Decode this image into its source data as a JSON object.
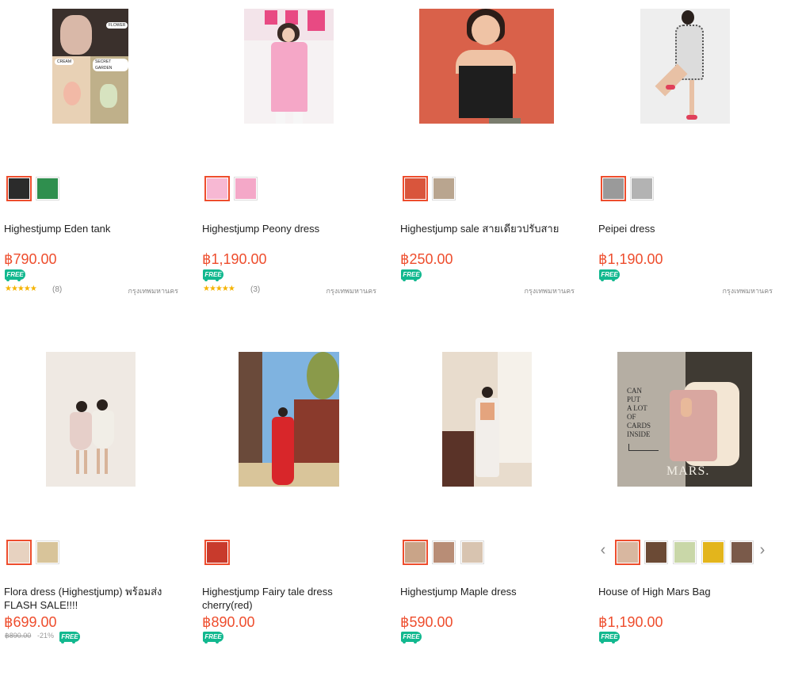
{
  "products": [
    {
      "name": "Highestjump Eden tank",
      "price": "฿790.00",
      "free_label": "FREE",
      "stars": "★★★★★",
      "reviews": "(8)",
      "location": "กรุงเทพมหานคร",
      "image_labels": [
        "FLOWER",
        "CREAM",
        "SECRET GARDEN"
      ],
      "swatch_colors": [
        "#2b2b2b",
        "#2f8f4e"
      ]
    },
    {
      "name": "Highestjump Peony dress",
      "price": "฿1,190.00",
      "free_label": "FREE",
      "stars": "★★★★★",
      "reviews": "(3)",
      "location": "กรุงเทพมหานคร",
      "swatch_colors": [
        "#f7b8d3",
        "#f4a8c8"
      ]
    },
    {
      "name": "Highestjump sale สายเดียวปรับสาย",
      "price": "฿250.00",
      "free_label": "FREE",
      "location": "กรุงเทพมหานคร",
      "swatch_colors": [
        "#d9553c",
        "#b9a58f"
      ]
    },
    {
      "name": "Peipei dress",
      "price": "฿1,190.00",
      "free_label": "FREE",
      "location": "กรุงเทพมหานคร",
      "swatch_colors": [
        "#9a9a9a",
        "#b3b3b3"
      ]
    },
    {
      "name": "Flora dress (Highestjump) พร้อมส่ง FLASH SALE!!!!",
      "price": "฿699.00",
      "old_price": "฿890.00",
      "discount": "-21%",
      "free_label": "FREE",
      "swatch_colors": [
        "#e7d2c0",
        "#d8c49a"
      ]
    },
    {
      "name": "Highestjump Fairy tale dress cherry(red)",
      "price": "฿890.00",
      "free_label": "FREE",
      "swatch_colors": [
        "#c83a2c"
      ]
    },
    {
      "name": "Highestjump Maple dress",
      "price": "฿590.00",
      "free_label": "FREE",
      "swatch_colors": [
        "#c9a488",
        "#b88d76",
        "#d8c4b0"
      ]
    },
    {
      "name": "House of High Mars Bag",
      "price": "฿1,190.00",
      "free_label": "FREE",
      "image_text": [
        "CAN",
        "PUT",
        "A LOT",
        "OF",
        "CARDS",
        "INSIDE"
      ],
      "image_brand": "MARS.",
      "swatch_colors": [
        "#d8b7a0",
        "#6b4a35",
        "#c9d7a8",
        "#e3b51c",
        "#7a5a4a"
      ],
      "nav": {
        "prev": "‹",
        "next": "›"
      }
    }
  ]
}
